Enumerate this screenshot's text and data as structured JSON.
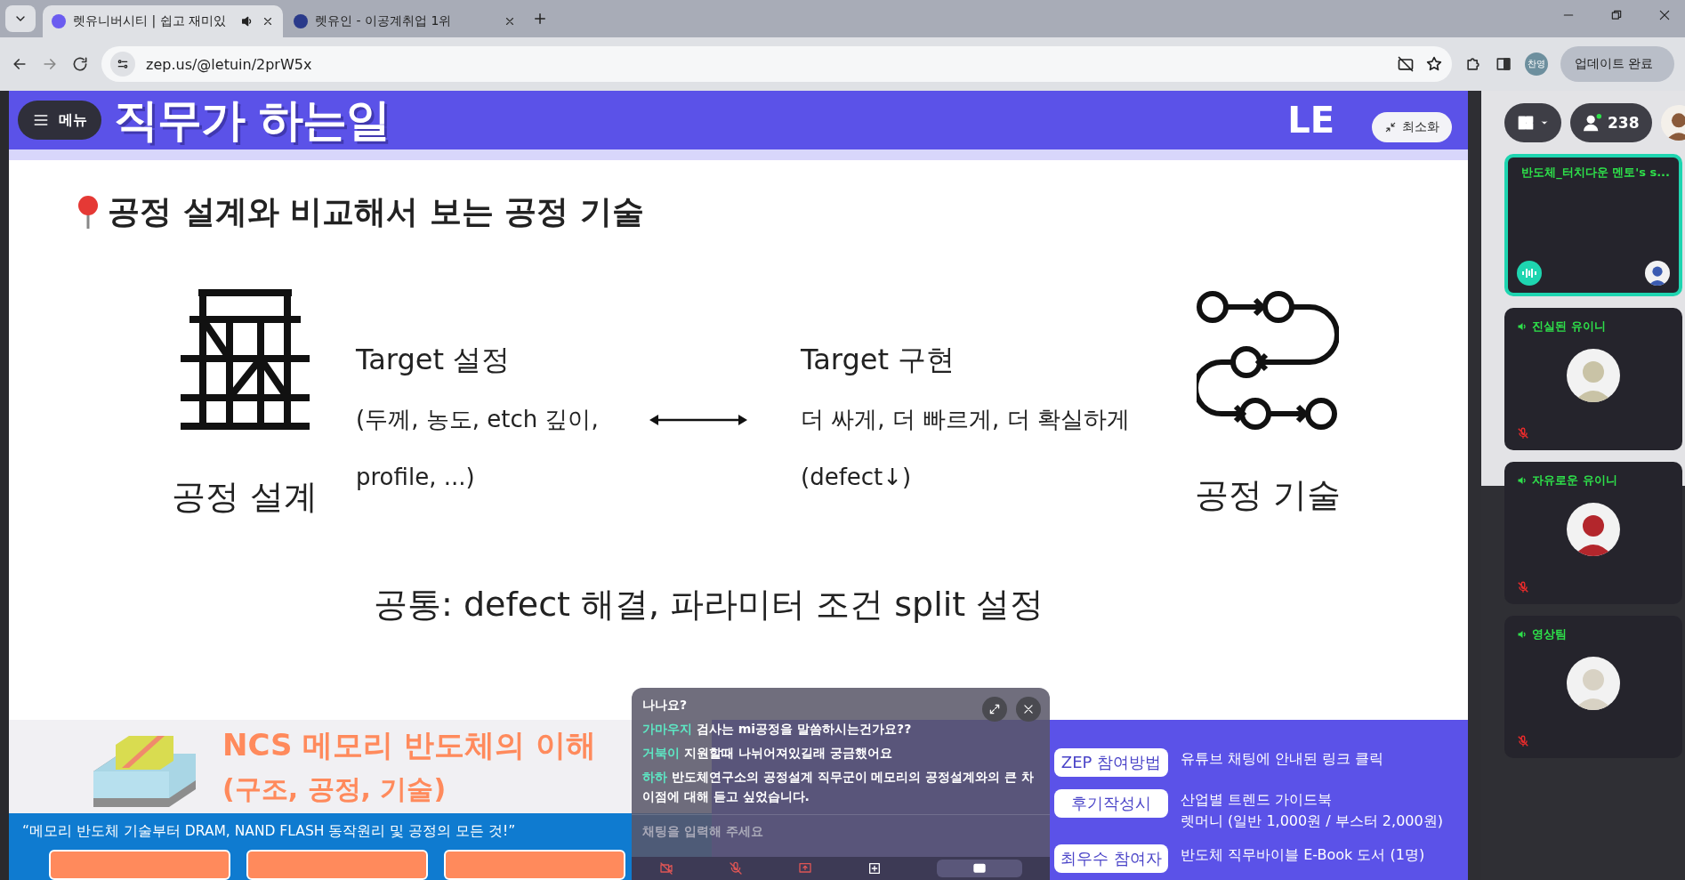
{
  "browser": {
    "tabs": [
      {
        "title": "렛유니버시티 | 쉽고 재미있",
        "selected": true,
        "audio": true
      },
      {
        "title": "렛유인 - 이공계취업 1위",
        "selected": false,
        "audio": false
      }
    ],
    "url": "zep.us/@letuin/2prW5x",
    "profile": "찬영",
    "update_button": "업데이트 완료"
  },
  "slide": {
    "menu_button": "메뉴",
    "title": "직무가 하는일",
    "logo": "LE",
    "minimize_button": "최소화",
    "heading": "공정 설계와 비교해서 보는 공정 기술",
    "left": {
      "label": "공정 설계",
      "target": "Target 설정",
      "details": [
        "(두께, 농도, etch 깊이,",
        "profile, ...)"
      ]
    },
    "right": {
      "label": "공정 기술",
      "target": "Target 구현",
      "details": [
        "더 싸게, 더 빠르게, 더 확실하게",
        "(defect↓)"
      ]
    },
    "common": "공통: defect 해결, 파라미터 조건 split 설정"
  },
  "banner": {
    "title": "**NCS** 메모리 반도체의 이해",
    "subtitle": "(구조, 공정, 기술)",
    "quote": "“메모리 반도체 기술부터 DRAM, NAND FLASH 동작원리 및 공정의 모든 것!”"
  },
  "info": [
    {
      "label": "ZEP 참여방법",
      "lines": [
        "유튜브 채팅에 안내된 링크 클릭"
      ]
    },
    {
      "label": "후기작성시",
      "lines": [
        "산업별 트렌드 가이드북",
        "렛머니 (일반 1,000원 / 부스터 2,000원)"
      ]
    },
    {
      "label": "최우수 참여자",
      "lines": [
        "반도체 직무바이블 E-Book 도서 (1명)"
      ]
    }
  ],
  "chat": {
    "messages": [
      {
        "text": "나나요?"
      },
      {
        "author": "가마우지",
        "text": "검사는 mi공정을 말씀하시는건가요??"
      },
      {
        "author": "거북이",
        "text": "지원할때 나뉘어져있길래 궁금했어요"
      },
      {
        "author": "하하",
        "text": "반도체연구소의 공정설계 직무군이 메모리의 공정설계와의 큰 차이점에 대해 듣고 싶었습니다."
      }
    ],
    "placeholder": "채팅을 입력해 주세요"
  },
  "participants": {
    "count": "238",
    "cards": [
      {
        "name": "반도체_터치다운 멘토's s...",
        "speaking": true,
        "muted": false
      },
      {
        "name": "진실된 유이니",
        "speaking": false,
        "muted": true
      },
      {
        "name": "자유로운 유이니",
        "speaking": false,
        "muted": true
      },
      {
        "name": "영상팀",
        "speaking": false,
        "muted": true
      }
    ]
  }
}
